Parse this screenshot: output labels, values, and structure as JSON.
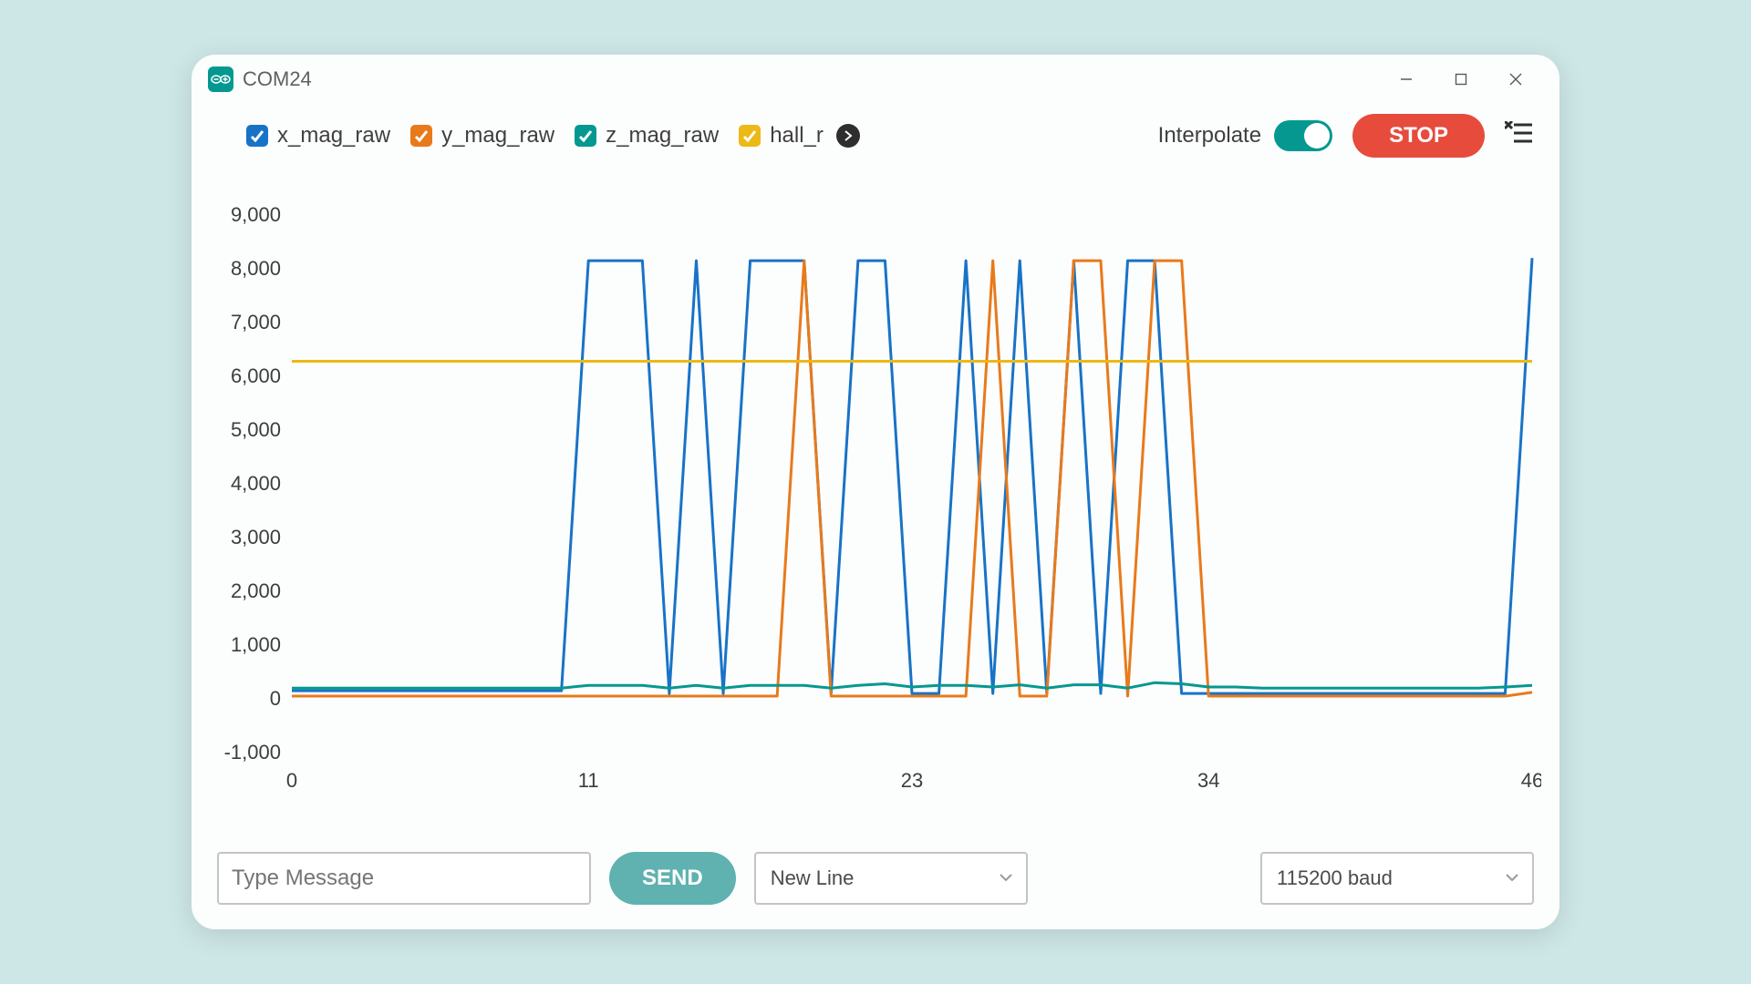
{
  "window": {
    "title": "COM24"
  },
  "legend": {
    "items": [
      {
        "label": "x_mag_raw",
        "color": "#1873c7"
      },
      {
        "label": "y_mag_raw",
        "color": "#e87a1b"
      },
      {
        "label": "z_mag_raw",
        "color": "#059890"
      },
      {
        "label": "hall_r",
        "color": "#ecb915"
      }
    ]
  },
  "toolbar": {
    "interpolate_label": "Interpolate",
    "interpolate_on": true,
    "stop_label": "STOP"
  },
  "footer": {
    "message_placeholder": "Type Message",
    "send_label": "SEND",
    "line_ending": "New Line",
    "baud": "115200 baud"
  },
  "chart_data": {
    "type": "line",
    "xlabel": "",
    "ylabel": "",
    "title": "",
    "xlim": [
      0,
      46
    ],
    "ylim": [
      -1000,
      9000
    ],
    "x_ticks": [
      0,
      11,
      23,
      34,
      46
    ],
    "y_ticks": [
      -1000,
      0,
      1000,
      2000,
      3000,
      4000,
      5000,
      6000,
      7000,
      8000,
      9000
    ],
    "y_tick_labels": [
      "-1,000",
      "0",
      "1,000",
      "2,000",
      "3,000",
      "4,000",
      "5,000",
      "6,000",
      "7,000",
      "8,000",
      "9,000"
    ],
    "x": [
      0,
      1,
      2,
      3,
      4,
      5,
      6,
      7,
      8,
      9,
      10,
      11,
      12,
      13,
      14,
      15,
      16,
      17,
      18,
      19,
      20,
      21,
      22,
      23,
      24,
      25,
      26,
      27,
      28,
      29,
      30,
      31,
      32,
      33,
      34,
      35,
      36,
      37,
      38,
      39,
      40,
      41,
      42,
      43,
      44,
      45,
      46
    ],
    "series": [
      {
        "name": "x_mag_raw",
        "color": "#1873c7",
        "values": [
          150,
          150,
          150,
          150,
          150,
          150,
          150,
          150,
          150,
          150,
          150,
          8150,
          8150,
          8150,
          100,
          8150,
          100,
          8150,
          8150,
          8150,
          100,
          8150,
          8150,
          100,
          100,
          8150,
          100,
          8150,
          100,
          8150,
          100,
          8150,
          8150,
          100,
          100,
          100,
          100,
          100,
          100,
          100,
          100,
          100,
          100,
          100,
          100,
          100,
          8200
        ]
      },
      {
        "name": "y_mag_raw",
        "color": "#e87a1b",
        "values": [
          50,
          50,
          50,
          50,
          50,
          50,
          50,
          50,
          50,
          50,
          50,
          50,
          50,
          50,
          50,
          50,
          50,
          50,
          50,
          8150,
          50,
          50,
          50,
          50,
          50,
          50,
          8150,
          50,
          50,
          8150,
          8150,
          50,
          8150,
          8150,
          50,
          50,
          50,
          50,
          50,
          50,
          50,
          50,
          50,
          50,
          50,
          50,
          120
        ]
      },
      {
        "name": "z_mag_raw",
        "color": "#059890",
        "values": [
          200,
          200,
          200,
          200,
          200,
          200,
          200,
          200,
          200,
          200,
          200,
          250,
          250,
          250,
          200,
          250,
          200,
          250,
          250,
          250,
          200,
          250,
          280,
          220,
          250,
          250,
          220,
          260,
          200,
          260,
          260,
          200,
          300,
          280,
          220,
          220,
          200,
          200,
          200,
          200,
          200,
          200,
          200,
          200,
          200,
          220,
          250
        ]
      },
      {
        "name": "hall_r",
        "color": "#ecb915",
        "values": [
          6280,
          6280,
          6280,
          6280,
          6280,
          6280,
          6280,
          6280,
          6280,
          6280,
          6280,
          6280,
          6280,
          6280,
          6280,
          6280,
          6280,
          6280,
          6280,
          6280,
          6280,
          6280,
          6280,
          6280,
          6280,
          6280,
          6280,
          6280,
          6280,
          6280,
          6280,
          6280,
          6280,
          6280,
          6280,
          6280,
          6280,
          6280,
          6280,
          6280,
          6280,
          6280,
          6280,
          6280,
          6280,
          6280,
          6280
        ]
      }
    ]
  }
}
